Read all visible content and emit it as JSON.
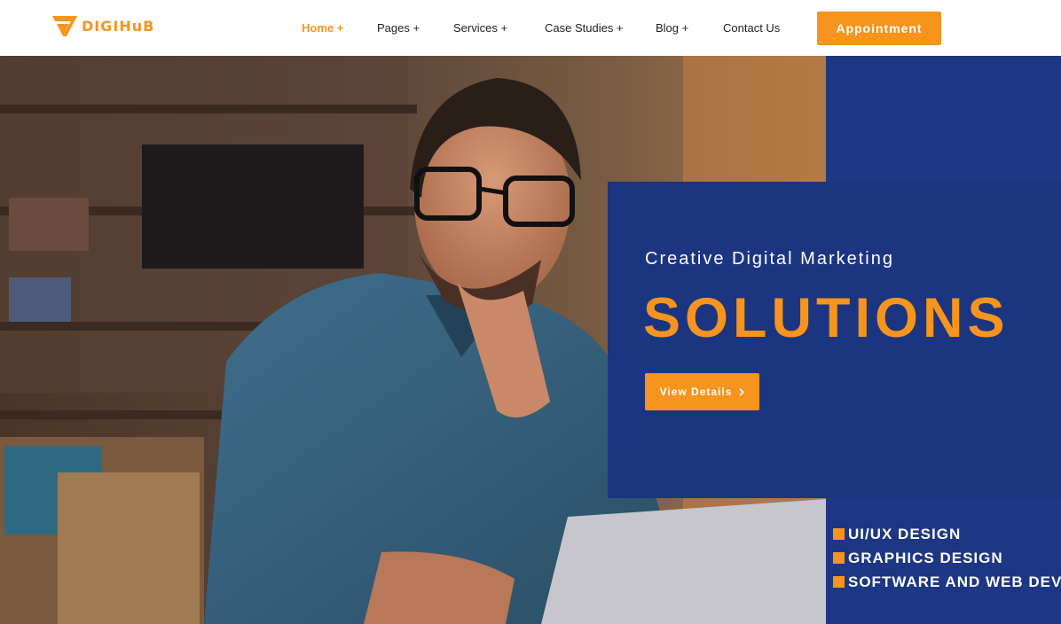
{
  "brand": {
    "name": "DIGIHuB"
  },
  "nav": {
    "items": [
      {
        "label": "Home +",
        "active": true
      },
      {
        "label": "Pages +",
        "active": false
      },
      {
        "label": "Services  +",
        "active": false
      },
      {
        "label": "Case Studies +",
        "active": false
      },
      {
        "label": "Blog +",
        "active": false
      },
      {
        "label": "Contact Us",
        "active": false
      }
    ],
    "cta_label": "Appointment"
  },
  "hero": {
    "subtitle": "Creative Digital Marketing",
    "title": "SOLUTIONS",
    "button_label": "View Details",
    "button_icon": "chevron-right-icon"
  },
  "services": [
    "UI/UX  DESIGN",
    "GRAPHICS DESIGN",
    "SOFTWARE AND WEB DEV"
  ],
  "colors": {
    "accent": "#f7941d",
    "navy": "#1b3580",
    "white": "#ffffff",
    "text": "#1f1f1f"
  }
}
